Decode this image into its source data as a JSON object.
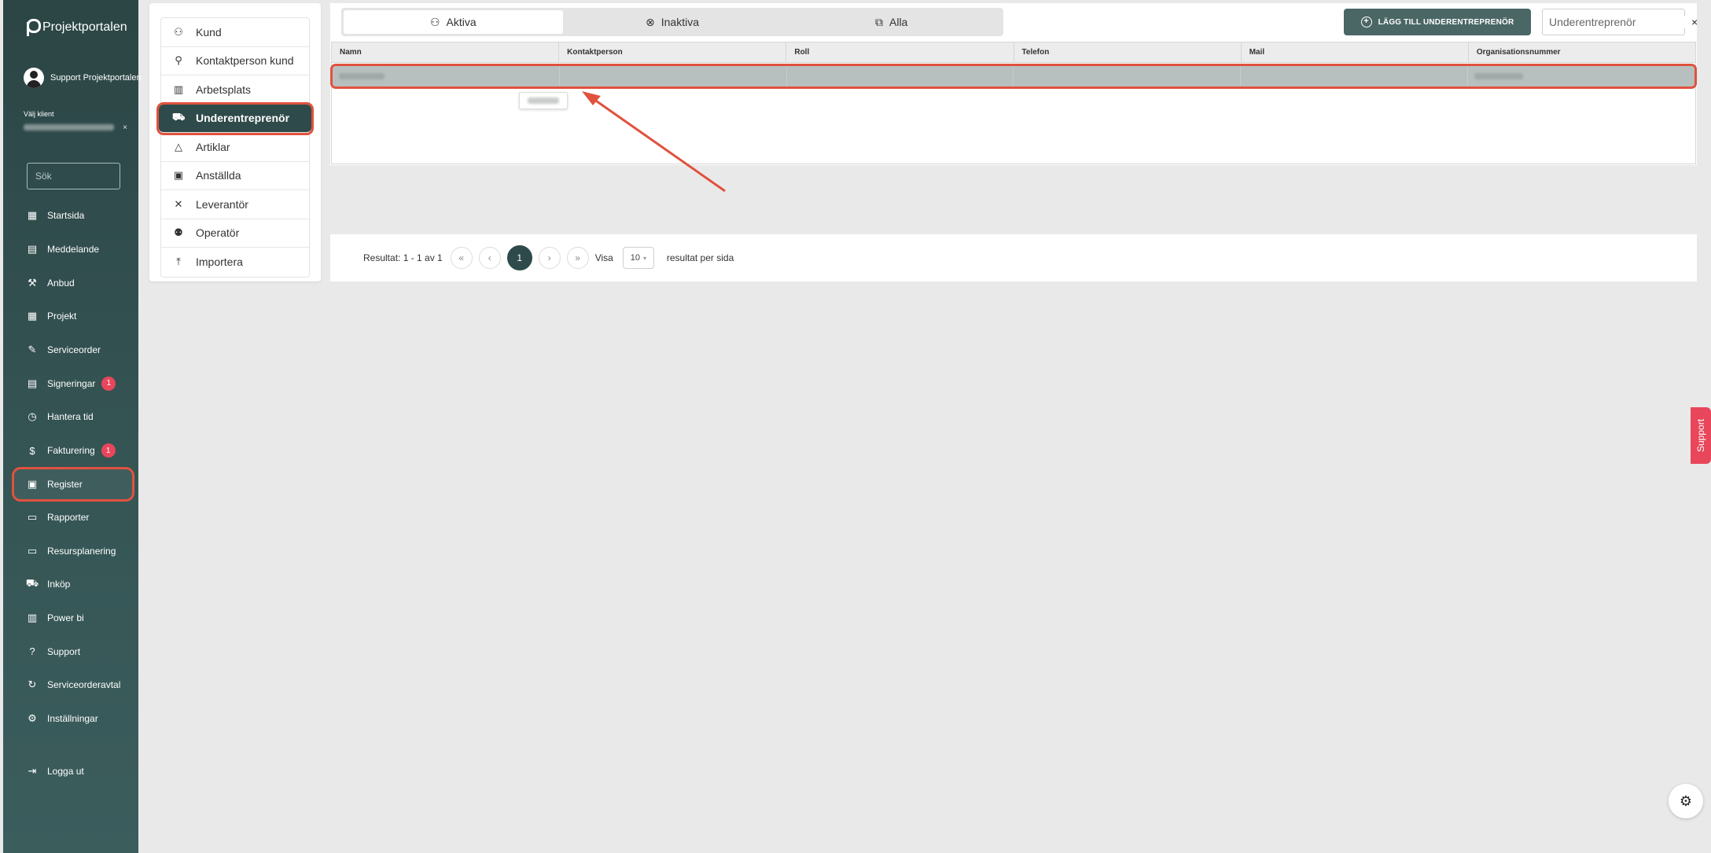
{
  "app": {
    "name": "Projektportalen"
  },
  "user": {
    "name": "Support Projektportalen",
    "client_label": "Välj klient"
  },
  "sidebar": {
    "search_placeholder": "Sök",
    "items": [
      {
        "label": "Startsida",
        "icon": "dashboard-icon"
      },
      {
        "label": "Meddelande",
        "icon": "message-icon"
      },
      {
        "label": "Anbud",
        "icon": "gavel-icon"
      },
      {
        "label": "Projekt",
        "icon": "grid-icon"
      },
      {
        "label": "Serviceorder",
        "icon": "wrench-icon"
      },
      {
        "label": "Signeringar",
        "icon": "signature-icon",
        "badge": "1"
      },
      {
        "label": "Hantera tid",
        "icon": "clock-icon"
      },
      {
        "label": "Fakturering",
        "icon": "dollar-icon",
        "badge": "1"
      },
      {
        "label": "Register",
        "icon": "register-icon",
        "active": true
      },
      {
        "label": "Rapporter",
        "icon": "calendar-icon"
      },
      {
        "label": "Resursplanering",
        "icon": "calendar-icon"
      },
      {
        "label": "Inköp",
        "icon": "cart-icon"
      },
      {
        "label": "Power bi",
        "icon": "chart-icon"
      },
      {
        "label": "Support",
        "icon": "help-icon"
      },
      {
        "label": "Serviceorderavtal",
        "icon": "refresh-icon"
      },
      {
        "label": "Inställningar",
        "icon": "gear-icon"
      }
    ],
    "logout": "Logga ut"
  },
  "register_menu": {
    "items": [
      {
        "label": "Kund",
        "icon": "people-icon"
      },
      {
        "label": "Kontaktperson kund",
        "icon": "contact-search-icon"
      },
      {
        "label": "Arbetsplats",
        "icon": "building-icon"
      },
      {
        "label": "Underentreprenör",
        "icon": "truck-icon",
        "active": true
      },
      {
        "label": "Artiklar",
        "icon": "shapes-icon"
      },
      {
        "label": "Anställda",
        "icon": "badge-icon"
      },
      {
        "label": "Leverantör",
        "icon": "tools-icon"
      },
      {
        "label": "Operatör",
        "icon": "operator-icon"
      },
      {
        "label": "Importera",
        "icon": "upload-icon"
      }
    ]
  },
  "tabs": [
    {
      "label": "Aktiva",
      "icon": "person-icon",
      "active": true
    },
    {
      "label": "Inaktiva",
      "icon": "x-circle-icon"
    },
    {
      "label": "Alla",
      "icon": "copy-icon"
    }
  ],
  "toolbar": {
    "add_label": "LÄGG TILL UNDERENTREPRENÖR",
    "filter_placeholder": "Underentreprenör",
    "clear": "×"
  },
  "table": {
    "columns": [
      "Namn",
      "Kontaktperson",
      "Roll",
      "Telefon",
      "Mail",
      "Organisationsnummer"
    ]
  },
  "pagination": {
    "result_text": "Resultat: 1 - 1 av 1",
    "first": "«",
    "prev": "‹",
    "current": "1",
    "next": "›",
    "last": "»",
    "show_label": "Visa",
    "per_page": "10",
    "per_page_suffix": "resultat per sida"
  },
  "support_tab": "Support",
  "colors": {
    "sidebar": "#2c4545",
    "accent": "#2f4a4a",
    "highlight": "#e0523e",
    "badge": "#e8465b",
    "button": "#4a6665"
  }
}
